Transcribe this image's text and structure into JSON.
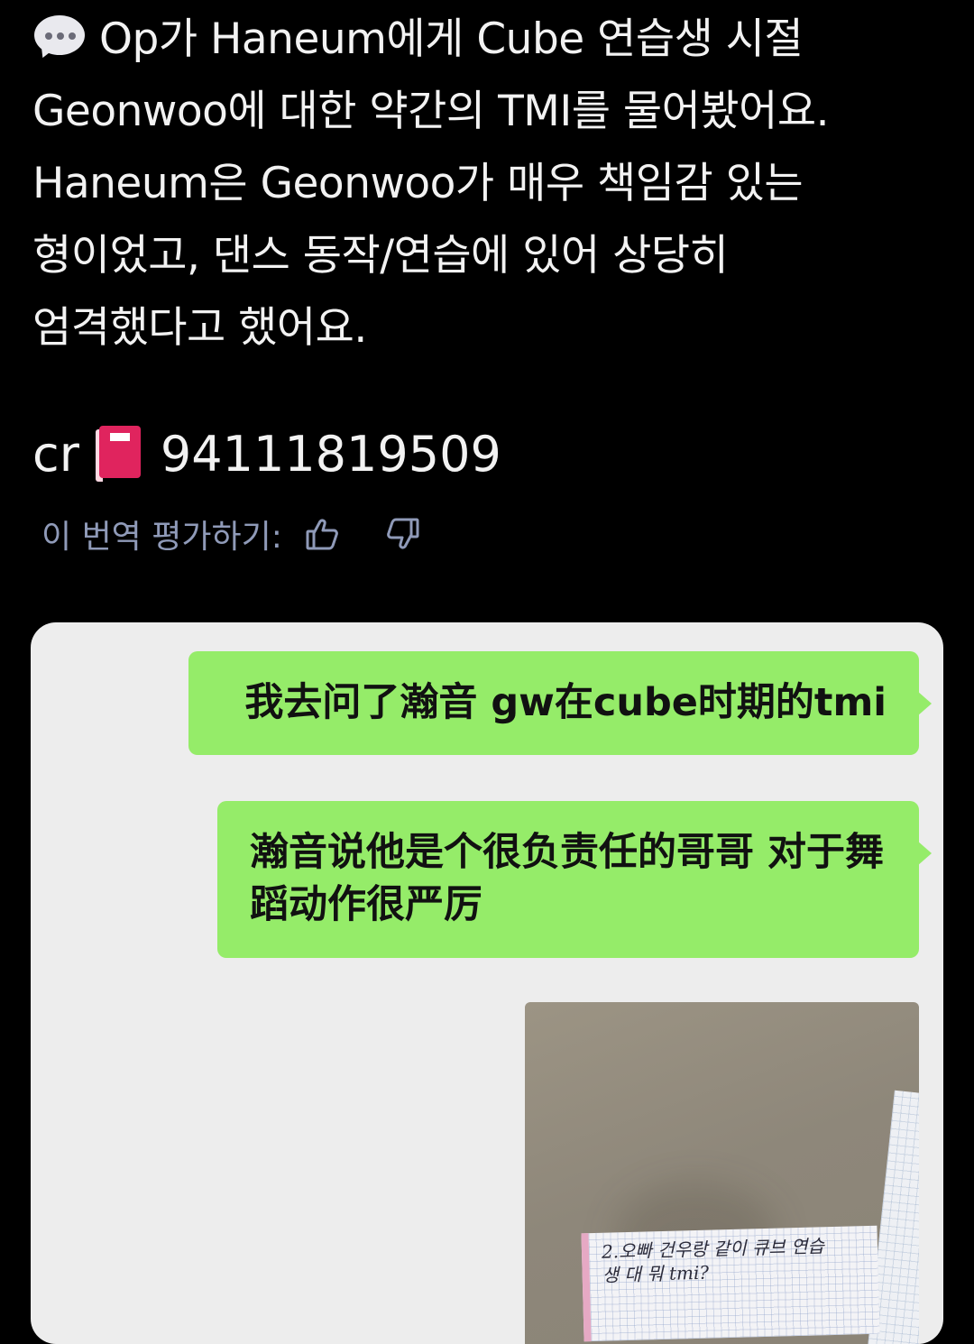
{
  "post": {
    "lines": [
      "Op가 Haneum에게 Cube 연습생 시절",
      "Geonwoo에 대한 약간의 TMI를 물어봤어요.",
      "Haneum은 Geonwoo가 매우 책임감 있는",
      "형이었고, 댄스 동작/연습에 있어 상당히",
      "엄격했다고 했어요."
    ],
    "leading_icon": "speech-balloon-icon"
  },
  "credit": {
    "prefix": "cr",
    "icon": "red-book-icon",
    "id": "94111819509"
  },
  "translation_rating": {
    "label": "이 번역 평가하기:",
    "up_icon": "thumbs-up-icon",
    "down_icon": "thumbs-down-icon"
  },
  "chat": {
    "messages": [
      {
        "text": "我去问了瀚音 gw在cube时期的tmi",
        "side": "right"
      },
      {
        "text": "瀚音说他是个很负责任的哥哥 对于舞蹈动作很严厉",
        "side": "right"
      }
    ],
    "photo_caption_lines": [
      "2.오빠 건우랑 같이 큐브 연습",
      "생 대 뭐 tmi?"
    ],
    "bubble_color": "#95ec69",
    "background_color": "#ededed"
  }
}
